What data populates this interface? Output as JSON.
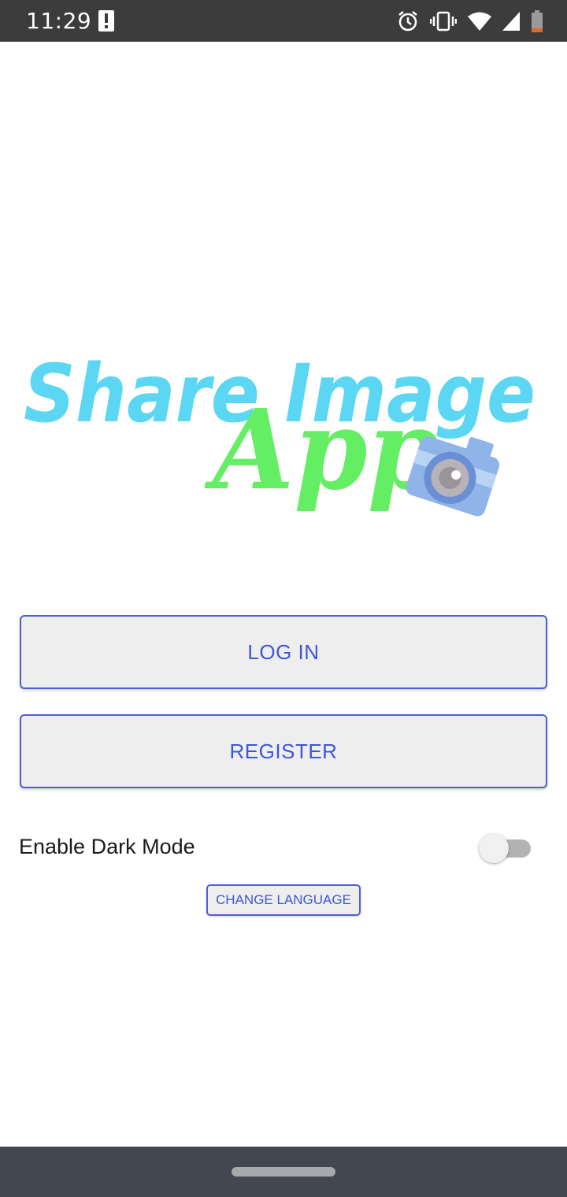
{
  "status_bar": {
    "time": "11:29",
    "icons": [
      "alert-icon",
      "alarm-icon",
      "vibrate-icon",
      "wifi-icon",
      "signal-icon",
      "battery-icon"
    ]
  },
  "logo": {
    "line1": "Share Image",
    "line2": "App",
    "colors": {
      "line1": "#5bd6f3",
      "line2": "#63ee63"
    }
  },
  "buttons": {
    "login": "LOG IN",
    "register": "REGISTER",
    "change_language": "CHANGE LANGUAGE"
  },
  "settings": {
    "dark_mode_label": "Enable Dark Mode",
    "dark_mode_enabled": false
  },
  "theme": {
    "accent": "#3e57d6",
    "button_bg": "#eeeeee",
    "status_bar_bg": "#3c3c3c",
    "nav_bar_bg": "#434850"
  }
}
